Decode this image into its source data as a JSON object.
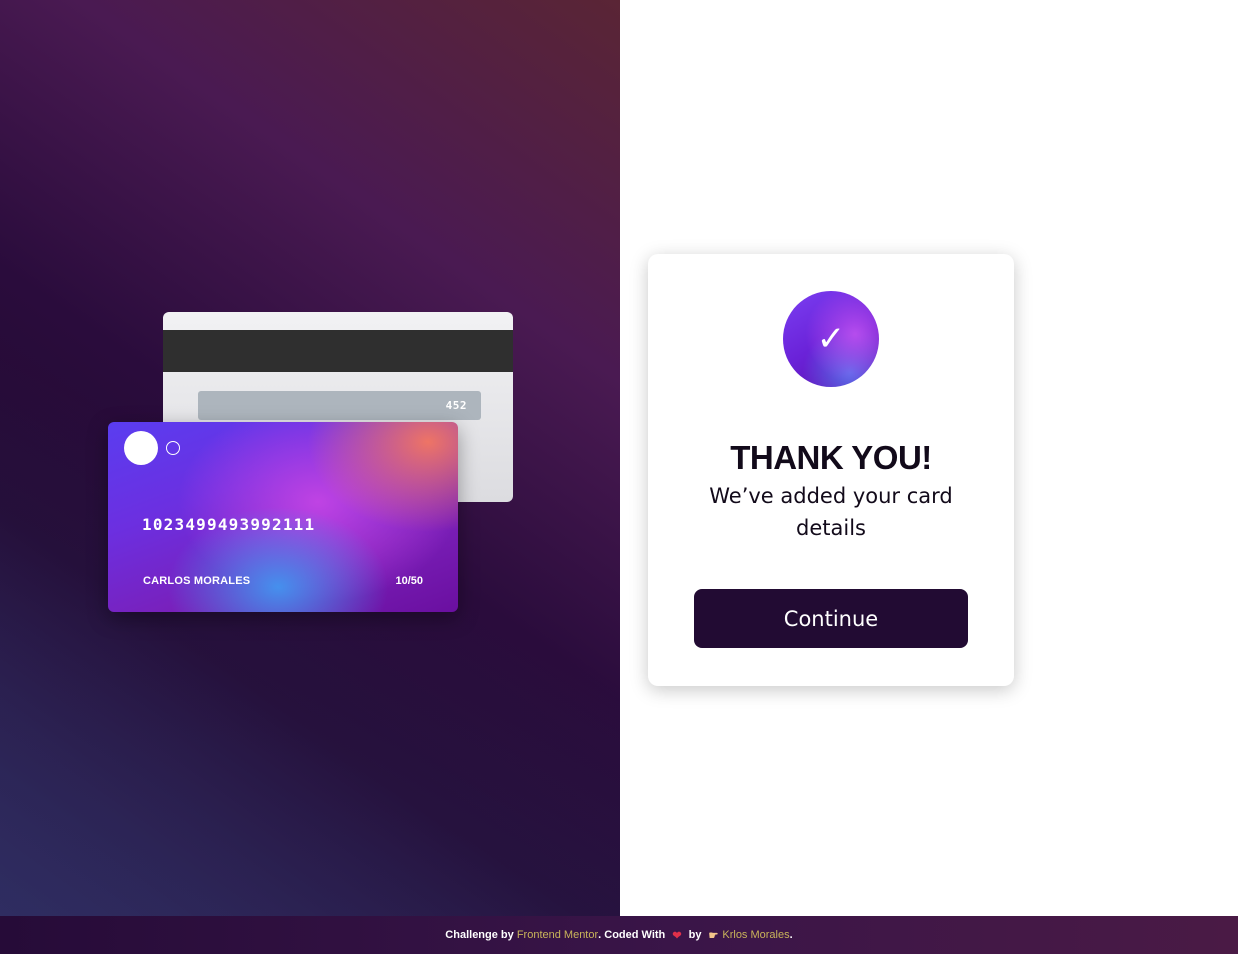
{
  "card_back": {
    "cvc": "452"
  },
  "card_front": {
    "number": "1023499493992111",
    "holder": "CARLOS MORALES",
    "expiry": "10/50"
  },
  "dialog": {
    "check_icon": "✓",
    "title": "THANK YOU!",
    "message": "We’ve added your card details",
    "continue_label": "Continue"
  },
  "footer": {
    "challenge_prefix": "Challenge by ",
    "frontend_mentor_link": "Frontend Mentor",
    "coded_with": ". Coded With ",
    "heart_icon": "❤",
    "by_text": " by ",
    "hand_icon": "☛",
    "author_link": "Krlos Morales",
    "end": "."
  },
  "colors": {
    "button_bg": "#220b33",
    "link": "#c9b45a",
    "accent_gradient_start": "#7b3ff2",
    "accent_gradient_end": "#5a0fa8"
  }
}
